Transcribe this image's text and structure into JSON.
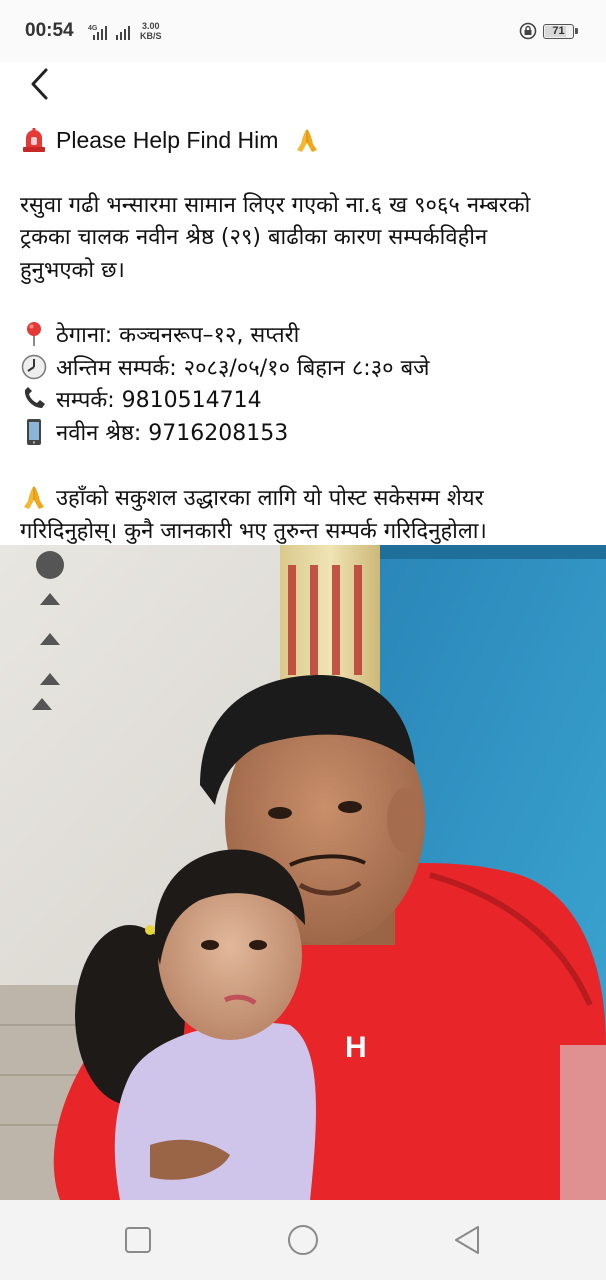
{
  "status_bar": {
    "time": "00:54",
    "network": "4G",
    "speed_value": "3.00",
    "speed_unit": "KB/S",
    "battery": "71"
  },
  "post": {
    "title": "Please Help Find Him",
    "description_lines": [
      "रसुवा गढी भन्सारमा सामान लिएर गएको ना.६ ख ९०६५ नम्बरको",
      "ट्रकका चालक नवीन श्रेष्ठ (२९) बाढीका कारण सम्पर्कविहीन",
      "हुनुभएको छ।"
    ],
    "address": "ठेगाना: कञ्चनरूप–१२, सप्तरी",
    "last_contact": "अन्तिम सम्पर्क: २०८३/०५/१० बिहान ८:३० बजे",
    "contact": "सम्पर्क: 9810514714",
    "naveen_phone": "नवीन श्रेष्ठ: 9716208153",
    "appeal_lines": [
      "उहाँको सकुशल उद्धारका लागि यो पोस्ट सकेसम्म शेयर",
      "गरिदिनुहोस्। कुनै जानकारी भए तुरुन्त सम्पर्क गरिदिनुहोला।"
    ]
  },
  "photo": {
    "shirt_logo": "H"
  },
  "icons": {
    "siren": "siren-icon",
    "pray": "folded-hands-icon",
    "pin": "round-pushpin-icon",
    "clock": "clock-icon",
    "phone": "telephone-receiver-icon",
    "mobile": "mobile-phone-icon"
  },
  "colors": {
    "jacket_red": "#e8262a",
    "background": "#ffffff",
    "nav_bar": "#f3f3f3"
  }
}
